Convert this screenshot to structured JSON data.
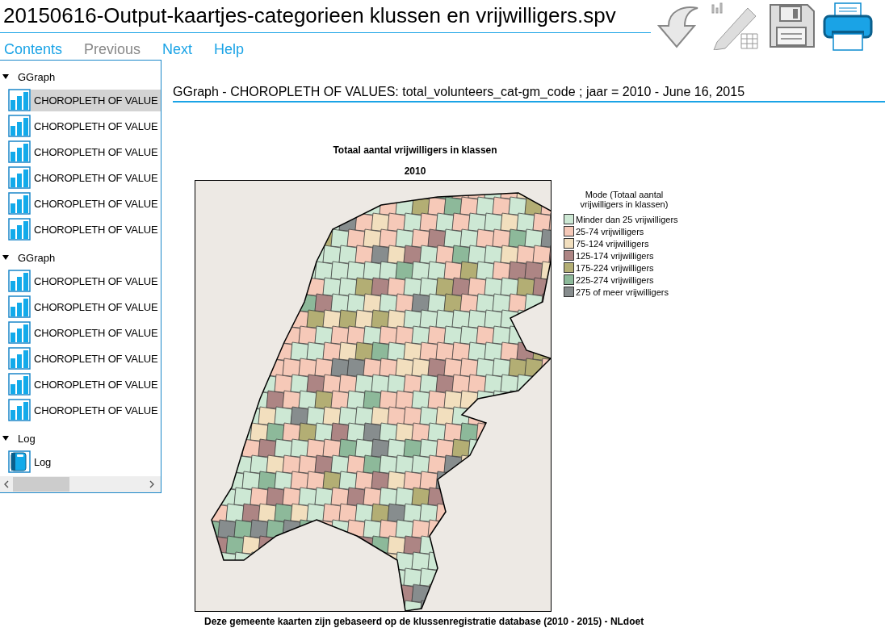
{
  "window": {
    "title": "20150616-Output-kaartjes-categorieen klussen en vrijwilligers.spv"
  },
  "nav": [
    {
      "label": "Contents",
      "disabled": false
    },
    {
      "label": "Previous",
      "disabled": true
    },
    {
      "label": "Next",
      "disabled": false
    },
    {
      "label": "Help",
      "disabled": false
    }
  ],
  "toolbar": [
    {
      "kind": "undo"
    },
    {
      "kind": "edit"
    },
    {
      "kind": "save"
    },
    {
      "kind": "print"
    }
  ],
  "outline": [
    {
      "label": "GGraph",
      "expanded": true,
      "children": [
        {
          "label": "CHOROPLETH OF VALUE",
          "kind": "chart",
          "selected": true
        },
        {
          "label": "CHOROPLETH OF VALUE",
          "kind": "chart",
          "selected": false
        },
        {
          "label": "CHOROPLETH OF VALUE",
          "kind": "chart",
          "selected": false
        },
        {
          "label": "CHOROPLETH OF VALUE",
          "kind": "chart",
          "selected": false
        },
        {
          "label": "CHOROPLETH OF VALUE",
          "kind": "chart",
          "selected": false
        },
        {
          "label": "CHOROPLETH OF VALUE",
          "kind": "chart",
          "selected": false
        }
      ]
    },
    {
      "label": "GGraph",
      "expanded": true,
      "children": [
        {
          "label": "CHOROPLETH OF VALUE",
          "kind": "chart",
          "selected": false
        },
        {
          "label": "CHOROPLETH OF VALUE",
          "kind": "chart",
          "selected": false
        },
        {
          "label": "CHOROPLETH OF VALUE",
          "kind": "chart",
          "selected": false
        },
        {
          "label": "CHOROPLETH OF VALUE",
          "kind": "chart",
          "selected": false
        },
        {
          "label": "CHOROPLETH OF VALUE",
          "kind": "chart",
          "selected": false
        },
        {
          "label": "CHOROPLETH OF VALUE",
          "kind": "chart",
          "selected": false
        }
      ]
    },
    {
      "label": "Log",
      "expanded": true,
      "children": [
        {
          "label": "Log",
          "kind": "log",
          "selected": false
        }
      ]
    }
  ],
  "content": {
    "heading": "GGraph - CHOROPLETH OF VALUES: total_volunteers_cat-gm_code ; jaar = 2010 - June 16, 2015",
    "chart_title": "Totaal aantal vrijwilligers in klassen",
    "chart_subtitle": "2010",
    "legend": {
      "title": "Mode (Totaal aantal vrijwilligers in klassen)",
      "items": [
        {
          "label": "Minder dan 25 vrijwilligers",
          "color": "#cde8d4"
        },
        {
          "label": "25-74 vrijwilligers",
          "color": "#f6c9b8"
        },
        {
          "label": "75-124 vrijwilligers",
          "color": "#f2dfbe"
        },
        {
          "label": "125-174 vrijwilligers",
          "color": "#ad8584"
        },
        {
          "label": "175-224 vrijwilligers",
          "color": "#b3ae74"
        },
        {
          "label": "225-274 vrijwilligers",
          "color": "#8db99a"
        },
        {
          "label": "275 of meer vrijwilligers",
          "color": "#878d8e"
        }
      ]
    },
    "footnote": "Deze gemeente kaarten zijn gebaseerd op de klussenregistratie database (2010 - 2015) - NLdoet"
  }
}
